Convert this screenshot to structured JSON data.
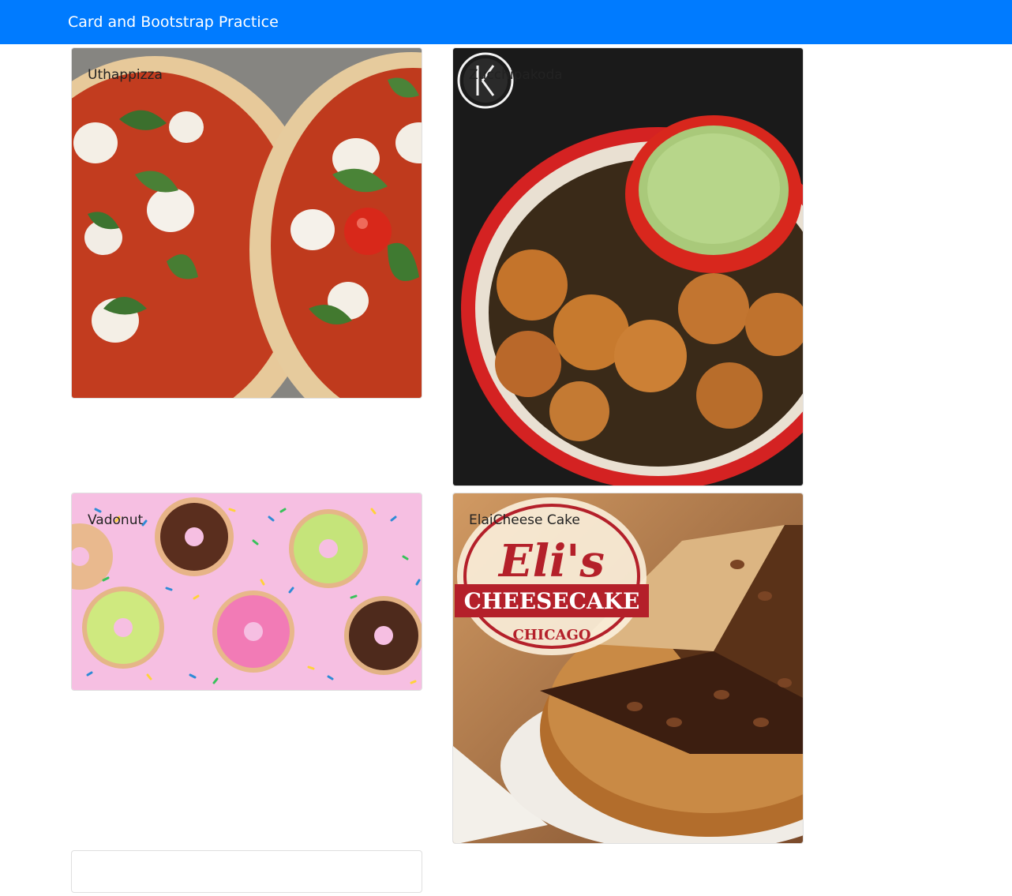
{
  "navbar": {
    "brand": "Card and Bootstrap Practice"
  },
  "cards": [
    {
      "title": "Uthappizza",
      "image": "pizza-photo"
    },
    {
      "title": "Zucchipakoda",
      "image": "pakoda-photo"
    },
    {
      "title": "Vadonut",
      "image": "donut-photo"
    },
    {
      "title": "ElaiCheese Cake",
      "image": "cheesecake-photo",
      "logo_text": [
        "Eli's",
        "CHEESECAKE",
        "CHICAGO"
      ]
    },
    {
      "title": "",
      "image": ""
    }
  ],
  "colors": {
    "navbar": "#007bff",
    "brand_text": "#ffffff"
  }
}
